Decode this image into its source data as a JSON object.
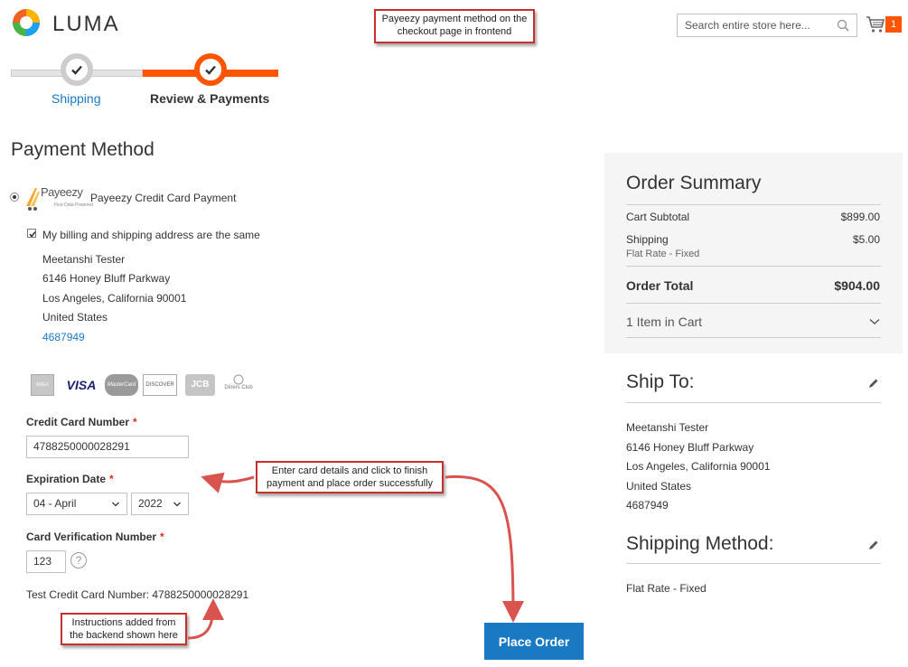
{
  "header": {
    "logo_text": "LUMA",
    "search_placeholder": "Search entire store here...",
    "cart_count": "1",
    "accent": "#ff5501"
  },
  "callouts": {
    "top": "Payeezy payment method on the checkout page in frontend",
    "middle": "Enter card details and click to finish payment and place order successfully",
    "bottom": "Instructions added from the backend shown here"
  },
  "progress": {
    "step1": "Shipping",
    "step2": "Review & Payments"
  },
  "payment": {
    "title": "Payment Method",
    "method_label": "Payeezy Credit Card Payment",
    "logo_text": "Payeezy",
    "logo_sub": "First Data Powered",
    "billing_same_label": "My billing and shipping address are the same",
    "address": {
      "name": "Meetanshi Tester",
      "street": "6146 Honey Bluff Parkway",
      "city": "Los Angeles, California 90001",
      "country": "United States",
      "phone": "4687949"
    },
    "cards": [
      "AMEX",
      "VISA",
      "MasterCard",
      "DISCOVER",
      "JCB",
      "Diners Club"
    ],
    "cc_number_label": "Credit Card Number",
    "cc_number_value": "4788250000028291",
    "exp_label": "Expiration Date",
    "exp_month": "04 - April",
    "exp_year": "2022",
    "cvv_label": "Card Verification Number",
    "cvv_value": "123",
    "help_symbol": "?",
    "req_mark": "*",
    "test_card_text": "Test Credit Card Number: 4788250000028291",
    "place_order": "Place Order"
  },
  "summary": {
    "title": "Order Summary",
    "subtotal_label": "Cart Subtotal",
    "subtotal_value": "$899.00",
    "shipping_label": "Shipping",
    "shipping_sub": "Flat Rate - Fixed",
    "shipping_value": "$5.00",
    "total_label": "Order Total",
    "total_value": "$904.00",
    "items_label": "1 Item in Cart"
  },
  "ship_to": {
    "title": "Ship To:",
    "name": "Meetanshi Tester",
    "street": "6146 Honey Bluff Parkway",
    "city": "Los Angeles, California 90001",
    "country": "United States",
    "phone": "4687949"
  },
  "shipping_method": {
    "title": "Shipping Method:",
    "value": "Flat Rate - Fixed"
  }
}
